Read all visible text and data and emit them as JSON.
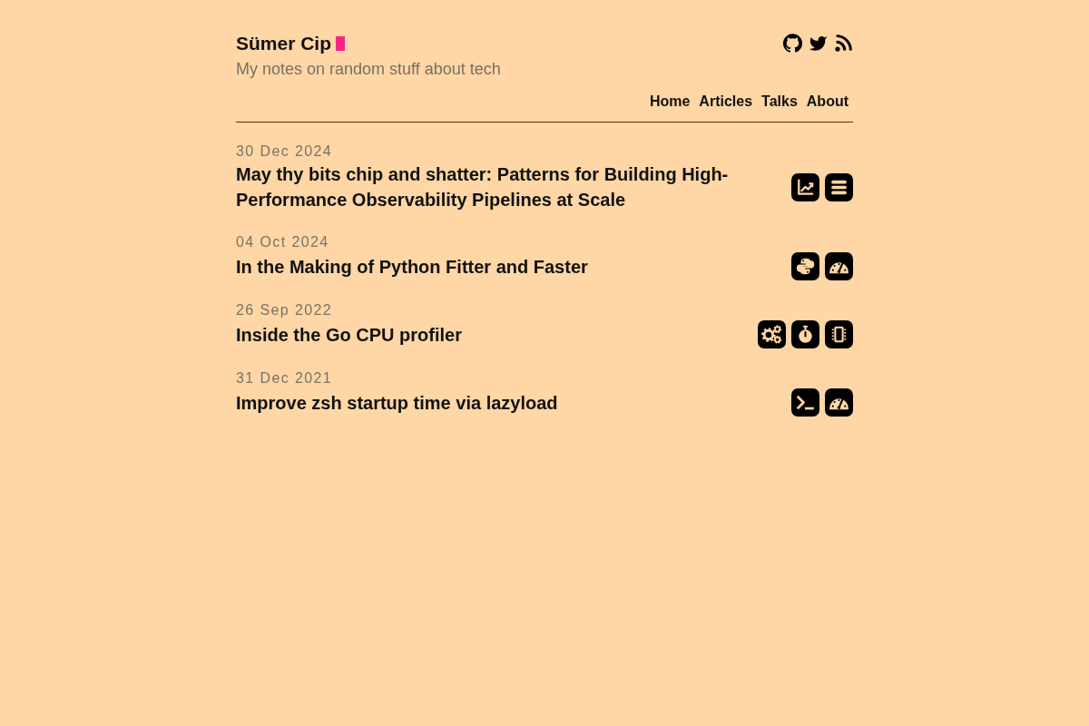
{
  "site": {
    "title": "Sümer Cip",
    "tagline": "My notes on random stuff about tech"
  },
  "nav": [
    "Home",
    "Articles",
    "Talks",
    "About"
  ],
  "posts": [
    {
      "date": "30 Dec 2024",
      "title": "May thy bits chip and shatter: Patterns for Building High-Performance Observability Pipelines at Scale",
      "tags": [
        {
          "kind": "chart"
        },
        {
          "kind": "list"
        }
      ]
    },
    {
      "date": "04 Oct 2024",
      "title": "In the Making of Python Fitter and Faster",
      "tags": [
        {
          "kind": "python"
        },
        {
          "kind": "gauge"
        }
      ]
    },
    {
      "date": "26 Sep 2022",
      "title": "Inside the Go CPU profiler",
      "tags": [
        {
          "kind": "gears"
        },
        {
          "kind": "stopwatch"
        },
        {
          "kind": "chip"
        }
      ]
    },
    {
      "date": "31 Dec 2021",
      "title": "Improve zsh startup time via lazyload",
      "tags": [
        {
          "kind": "terminal"
        },
        {
          "kind": "gauge"
        }
      ]
    }
  ]
}
